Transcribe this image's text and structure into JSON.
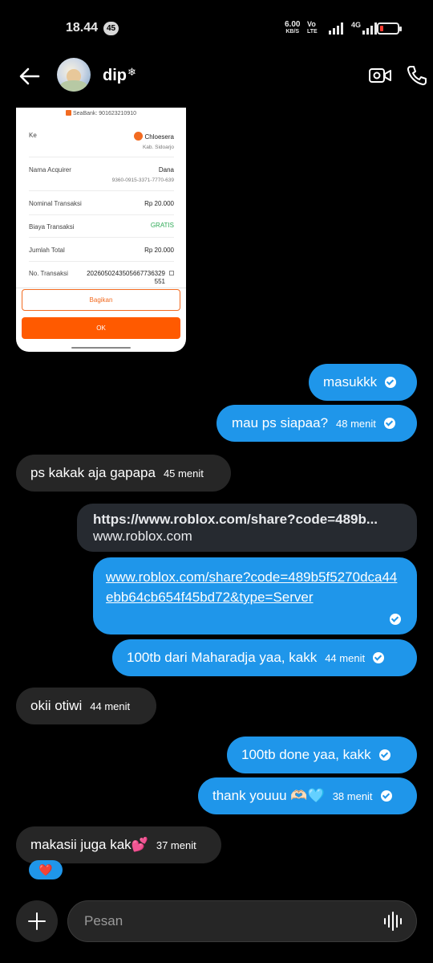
{
  "status_bar": {
    "time": "18.44",
    "badge": "45",
    "speed_value": "6.00",
    "speed_unit": "KB/S",
    "volte_top": "Vo",
    "volte_bottom": "LTE",
    "network": "4G",
    "battery_level": 0.1
  },
  "header": {
    "contact_name": "dip",
    "contact_emoji": "❄"
  },
  "receipt": {
    "bank_line": "SeaBank: 901623210910",
    "rows": [
      {
        "label": "Ke",
        "value": "Chloesera",
        "sub": "Kab. Sidoarjo"
      },
      {
        "label": "Nama Acquirer",
        "value": "Dana",
        "sub": "9360-0915-3371-7770-639"
      },
      {
        "label": "Nominal Transaksi",
        "value": "Rp 20.000"
      },
      {
        "label": "Biaya Transaksi",
        "value": "GRATIS"
      },
      {
        "label": "Jumlah Total",
        "value": "Rp 20.000"
      },
      {
        "label": "No. Transaksi",
        "value": "2026050243505667736329",
        "value2": "551"
      }
    ],
    "share_label": "Bagikan",
    "ok_label": "OK"
  },
  "messages": [
    {
      "dir": "out",
      "text": "masukkk",
      "time": ""
    },
    {
      "dir": "out",
      "text": "mau ps siapaa?",
      "time": "48 menit"
    },
    {
      "dir": "in",
      "text": "ps kakak aja gapapa",
      "time": "45 menit"
    },
    {
      "dir": "in",
      "type": "link-preview",
      "url": "https://www.roblox.com/share?code=489b...",
      "domain": "www.roblox.com"
    },
    {
      "dir": "out",
      "type": "link",
      "text": "www.roblox.com/share?code=489b5f5270dca44ebb64cb654f45bd72&type=Server"
    },
    {
      "dir": "out",
      "text": "100tb dari Maharadja yaa, kakk",
      "time": "44 menit"
    },
    {
      "dir": "in",
      "text": "okii otiwi",
      "time": "44 menit"
    },
    {
      "dir": "out",
      "text": "100tb done yaa, kakk",
      "time": ""
    },
    {
      "dir": "out",
      "text": "thank youuu 🫶🏻🩵",
      "time": "38 menit"
    },
    {
      "dir": "in",
      "text": "makasii juga kak💕",
      "time": "37 menit"
    }
  ],
  "reaction": "❤️",
  "composer": {
    "placeholder": "Pesan"
  },
  "colors": {
    "outgoing": "#1f96ea",
    "incoming": "#262626",
    "background": "#000000"
  }
}
